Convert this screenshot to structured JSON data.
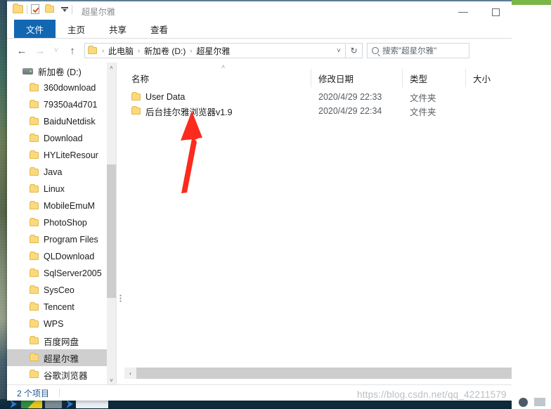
{
  "window": {
    "title": "超星尔雅",
    "quick_access": [
      {
        "name": "folder-icon",
        "label": ""
      },
      {
        "name": "properties-icon",
        "label": ""
      },
      {
        "name": "new-folder-icon",
        "label": ""
      },
      {
        "name": "customize-dropdown-icon",
        "label": ""
      }
    ],
    "controls": {
      "minimize": "—",
      "maximize": "□"
    }
  },
  "ribbon": {
    "tabs": [
      {
        "label": "文件",
        "active": true
      },
      {
        "label": "主页",
        "active": false
      },
      {
        "label": "共享",
        "active": false
      },
      {
        "label": "查看",
        "active": false
      }
    ]
  },
  "addressbar": {
    "back": "←",
    "forward": "→",
    "recent": "˅",
    "up": "↑",
    "breadcrumbs": [
      "此电脑",
      "新加卷 (D:)",
      "超星尔雅"
    ],
    "separator": "›",
    "dropdown": "˅",
    "refresh": "↻"
  },
  "search": {
    "placeholder": "搜索\"超星尔雅\"",
    "icon": "search-icon"
  },
  "navpane": {
    "drive": "新加卷 (D:)",
    "items": [
      {
        "label": "360download",
        "selected": false
      },
      {
        "label": "79350a4d701",
        "selected": false
      },
      {
        "label": "BaiduNetdisk",
        "selected": false
      },
      {
        "label": "Download",
        "selected": false
      },
      {
        "label": "HYLiteResour",
        "selected": false
      },
      {
        "label": "Java",
        "selected": false
      },
      {
        "label": "Linux",
        "selected": false
      },
      {
        "label": "MobileEmuM",
        "selected": false
      },
      {
        "label": "PhotoShop",
        "selected": false
      },
      {
        "label": "Program Files",
        "selected": false
      },
      {
        "label": "QLDownload",
        "selected": false
      },
      {
        "label": "SqlServer2005",
        "selected": false
      },
      {
        "label": "SysCeo",
        "selected": false
      },
      {
        "label": "Tencent",
        "selected": false
      },
      {
        "label": "WPS",
        "selected": false
      },
      {
        "label": "百度网盘",
        "selected": false
      },
      {
        "label": "超星尔雅",
        "selected": true
      },
      {
        "label": "谷歌浏览器",
        "selected": false
      }
    ],
    "scroll_up": "˄",
    "scroll_down": "˅"
  },
  "filelist": {
    "sort_indicator": "˄",
    "columns": [
      "名称",
      "修改日期",
      "类型",
      "大小"
    ],
    "rows": [
      {
        "name": "User Data",
        "date": "2020/4/29 22:33",
        "type": "文件夹",
        "size": ""
      },
      {
        "name": "后台挂尔雅浏览器v1.9",
        "date": "2020/4/29 22:34",
        "type": "文件夹",
        "size": ""
      }
    ],
    "hscroll_arrow": "‹"
  },
  "statusbar": {
    "item_count": "2 个项目"
  },
  "annotation": {
    "arrow_color": "#fb2b1e"
  },
  "watermark": {
    "text": "https://blog.csdn.net/qq_42211579"
  },
  "colors": {
    "accent": "#1267b3",
    "folder": "#fbd97c",
    "selected_row": "#cfcfcf",
    "green_bar": "#7ab648"
  }
}
